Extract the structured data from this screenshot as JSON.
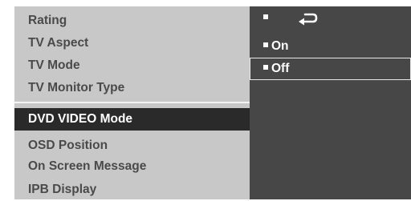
{
  "left_menu": {
    "items": [
      {
        "label": "Rating"
      },
      {
        "label": "TV Aspect"
      },
      {
        "label": "TV Mode"
      },
      {
        "label": "TV Monitor Type"
      },
      {
        "label": "DVD VIDEO Mode",
        "selected": true
      },
      {
        "label": "OSD  Position"
      },
      {
        "label": "On Screen Message"
      },
      {
        "label": "IPB Display"
      }
    ]
  },
  "options": {
    "return_icon": "return-arrow-icon",
    "items": [
      {
        "label": "On"
      },
      {
        "label": "Off",
        "highlighted": true
      }
    ]
  },
  "colors": {
    "menu_background": "#c8c8c8",
    "menu_text": "#4a4a4a",
    "selected_background": "#2a2a2a",
    "options_background": "#474747",
    "options_text": "#ffffff"
  }
}
